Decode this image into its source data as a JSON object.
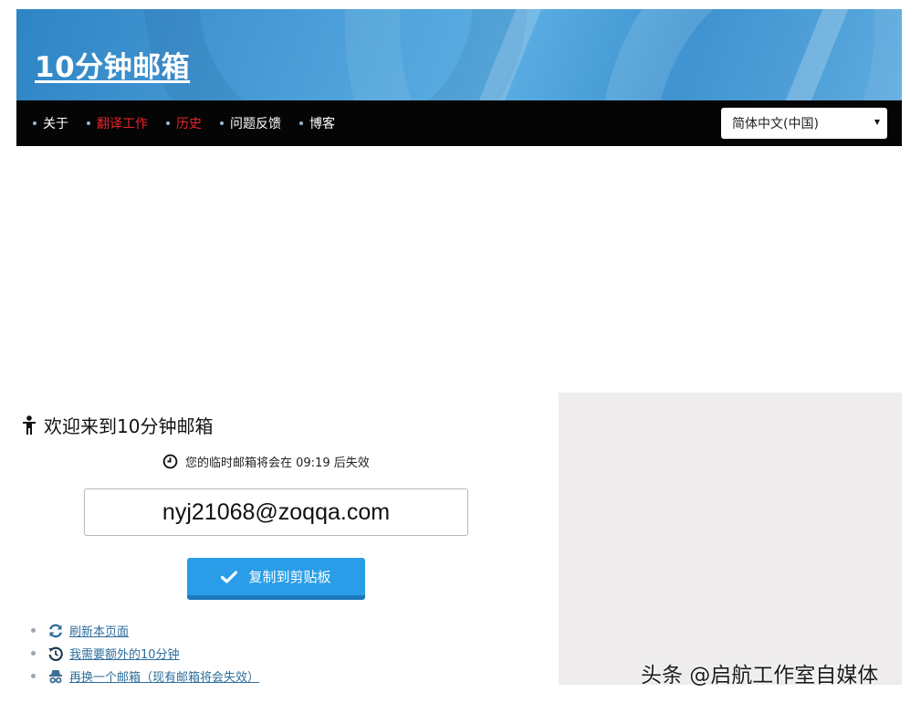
{
  "header": {
    "site_title": "10分钟邮箱"
  },
  "nav": {
    "items": [
      {
        "label": "关于",
        "color": "#ffffff"
      },
      {
        "label": "翻译工作",
        "color": "#e8232c"
      },
      {
        "label": "历史",
        "color": "#e8232c"
      },
      {
        "label": "问题反馈",
        "color": "#ffffff"
      },
      {
        "label": "博客",
        "color": "#ffffff"
      }
    ],
    "language_selected": "简体中文(中国)"
  },
  "main": {
    "welcome_title": "欢迎来到10分钟邮箱",
    "timer_text": "您的临时邮箱将会在 09:19 后失效",
    "email_address": "nyj21068@zoqqa.com",
    "copy_button_label": "复制到剪贴板",
    "links": [
      {
        "label": "刷新本页面",
        "icon": "refresh-icon"
      },
      {
        "label": "我需要额外的10分钟",
        "icon": "history-icon"
      },
      {
        "label": "再换一个邮箱（现有邮箱将会失效）",
        "icon": "incognito-icon"
      }
    ]
  },
  "watermark": "头条 @启航工作室自媒体",
  "colors": {
    "accent_blue": "#2a9de8",
    "nav_bg": "#050505",
    "link": "#2d6e9c",
    "nav_red": "#e8232c"
  }
}
